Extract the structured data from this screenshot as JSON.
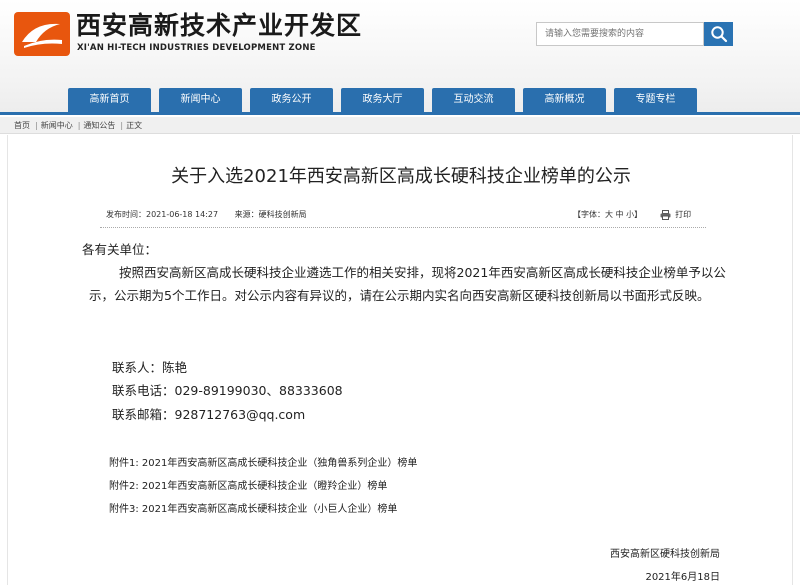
{
  "header": {
    "title": "西安高新技术产业开发区",
    "subtitle": "XI'AN HI-TECH INDUSTRIES DEVELOPMENT ZONE",
    "logo_icon": "xian-hitech-logo-icon",
    "brand_color": "#2a6fae",
    "accent_color": "#e8560e"
  },
  "search": {
    "placeholder": "请输入您需要搜索的内容",
    "icon": "search-icon"
  },
  "nav": {
    "items": [
      "高新首页",
      "新闻中心",
      "政务公开",
      "政务大厅",
      "互动交流",
      "高新概况",
      "专题专栏"
    ]
  },
  "breadcrumb": [
    "首页",
    "新闻中心",
    "通知公告",
    "正文"
  ],
  "article": {
    "title": "关于入选2021年西安高新区高成长硬科技企业榜单的公示",
    "publish_time": "发布时间：2021-06-18 14:27",
    "source": "来源：硬科技创新局",
    "font_size_label": "【字体：大 中 小】",
    "print_label": "打印",
    "greeting": "各有关单位：",
    "body": "按照西安高新区高成长硬科技企业遴选工作的相关安排，现将2021年西安高新区高成长硬科技企业榜单予以公示，公示期为5个工作日。对公示内容有异议的，请在公示期内实名向西安高新区硬科技创新局以书面形式反映。",
    "contacts": [
      "联系人：陈艳",
      "联系电话：029-89199030、88333608",
      "联系邮箱：928712763@qq.com"
    ],
    "attachments": [
      "附件1: 2021年西安高新区高成长硬科技企业（独角兽系列企业）榜单",
      "附件2: 2021年西安高新区高成长硬科技企业（瞪羚企业）榜单",
      "附件3: 2021年西安高新区高成长硬科技企业（小巨人企业）榜单"
    ],
    "signature_org": "西安高新区硬科技创新局",
    "signature_date": "2021年6月18日"
  }
}
